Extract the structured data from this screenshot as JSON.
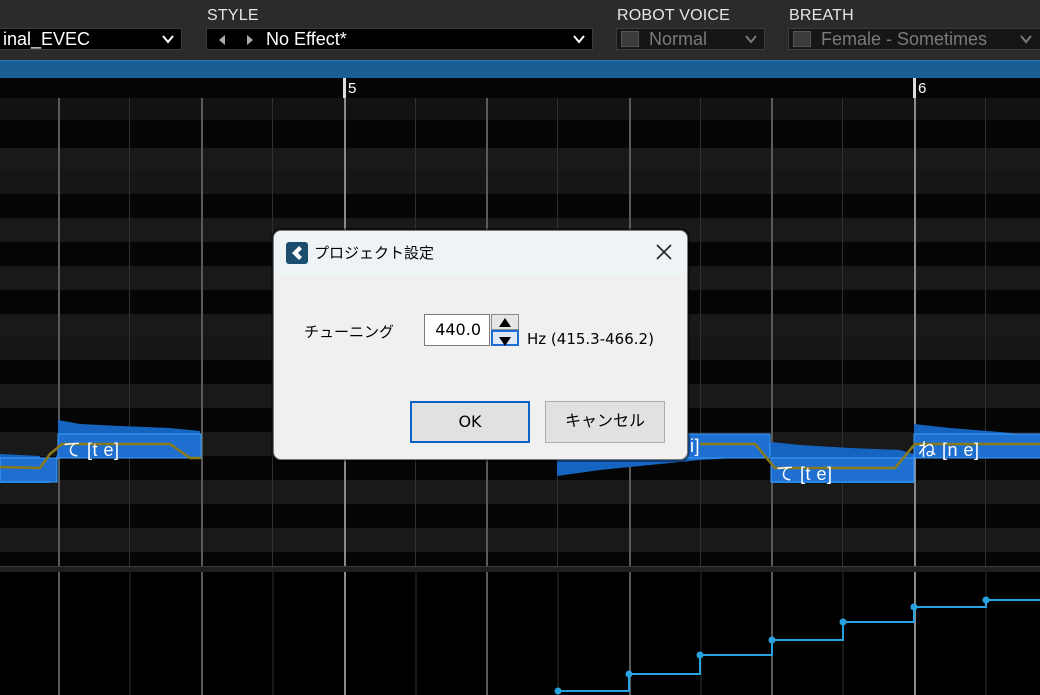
{
  "header": {
    "voice_value": "inal_EVEC",
    "style_label": "STYLE",
    "style_value": "No Effect*",
    "robot_label": "ROBOT VOICE",
    "robot_value": "Normal",
    "breath_label": "BREATH",
    "breath_value": "Female - Sometimes"
  },
  "ruler": {
    "bar_5": "5",
    "bar_6": "6"
  },
  "notes": [
    {
      "label": "て [t e]"
    },
    {
      "label": "i]"
    },
    {
      "label": "て [t e]"
    },
    {
      "label": "ね [n e]"
    }
  ],
  "dialog": {
    "title": "プロジェクト設定",
    "tuning_label": "チューニング",
    "tuning_value": "440.0",
    "hz_range": "Hz (415.3-466.2)",
    "ok_label": "OK",
    "cancel_label": "キャンセル"
  },
  "colors": {
    "accent_blue": "#1a5e96",
    "note_blue": "#1565c0",
    "pitch_line": "#8a7a1a",
    "automation_line": "#29a3e0"
  }
}
